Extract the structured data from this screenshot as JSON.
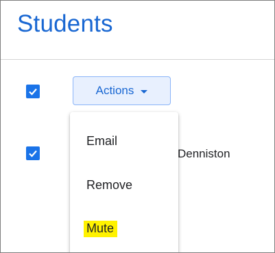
{
  "page": {
    "title": "Students"
  },
  "toolbar": {
    "actions_label": "Actions"
  },
  "students": [
    {
      "name": "Denniston",
      "checked": true
    }
  ],
  "menu": {
    "items": [
      {
        "label": "Email"
      },
      {
        "label": "Remove"
      },
      {
        "label": "Mute",
        "highlighted": true
      }
    ]
  },
  "colors": {
    "accent": "#1967d2",
    "checkbox": "#1a73e8",
    "button_bg": "#e8f0fe",
    "highlight": "#fff200"
  }
}
